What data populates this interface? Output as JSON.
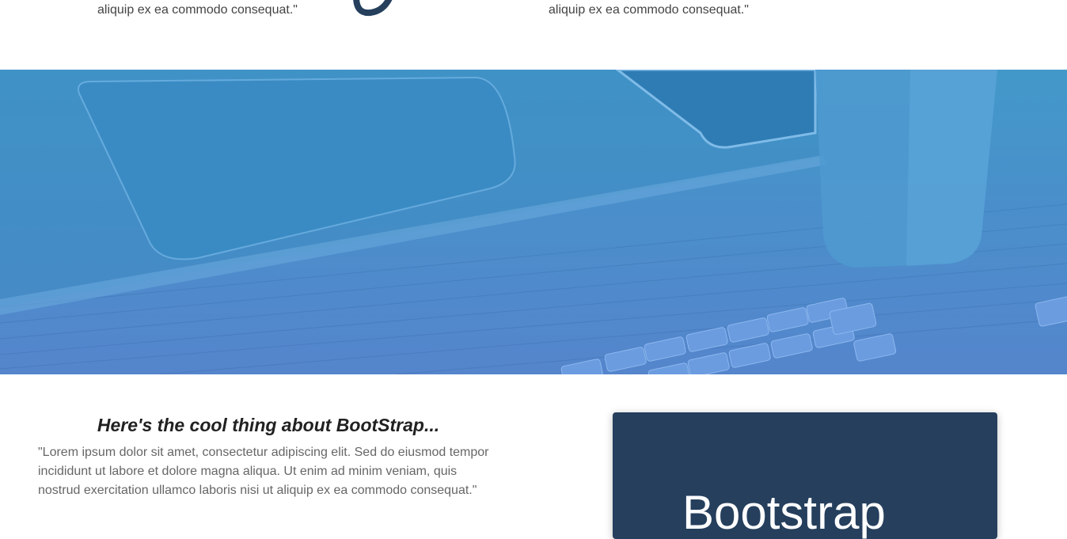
{
  "top_section": {
    "quote_left": "aliquip ex ea commodo consequat.\"",
    "quote_right": "aliquip ex ea commodo consequat.\"",
    "icon": "partial-logo-icon"
  },
  "hero": {
    "image": "desk-laptop-keyboard-photo-blue-overlay",
    "overlay_color": "#4a8fcb"
  },
  "feature": {
    "heading": "Here's the cool thing about BootStrap...",
    "paragraph": "\"Lorem ipsum dolor sit amet, consectetur adipiscing elit. Sed do eiusmod tempor incididunt ut labore et dolore magna aliqua. Ut enim ad minim veniam, quis nostrud exercitation ullamco laboris nisi ut aliquip ex ea commodo consequat.\""
  },
  "card": {
    "title": "Bootstrap",
    "background": "#253f5d"
  }
}
